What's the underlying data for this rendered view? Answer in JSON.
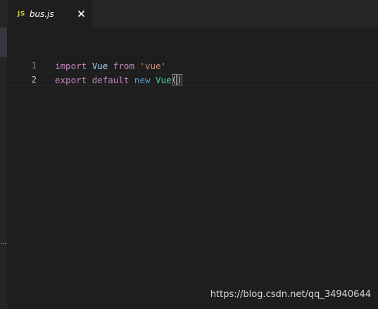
{
  "tab": {
    "icon_text": "JS",
    "icon_name": "javascript-file-icon",
    "file_name": "bus.js",
    "close_icon": "close-icon"
  },
  "sidebar": {
    "ellipsis": "..."
  },
  "editor": {
    "lines": [
      {
        "number": "1",
        "tokens": [
          "import",
          " ",
          "Vue",
          " ",
          "from",
          " ",
          "'vue'"
        ]
      },
      {
        "number": "2",
        "tokens": [
          "export",
          " ",
          "default",
          " ",
          "new",
          " ",
          "Vue",
          "(",
          ")"
        ]
      }
    ],
    "current_line": 2
  },
  "watermark": "https://blog.csdn.net/qq_34940644",
  "colors": {
    "background": "#1e1e1e",
    "tabbar": "#252526",
    "keyword": "#c586c0",
    "identifier": "#9cdcfe",
    "string": "#ce9178",
    "storage": "#569cd6",
    "class": "#4ec9b0",
    "js_icon": "#cbcb41"
  }
}
